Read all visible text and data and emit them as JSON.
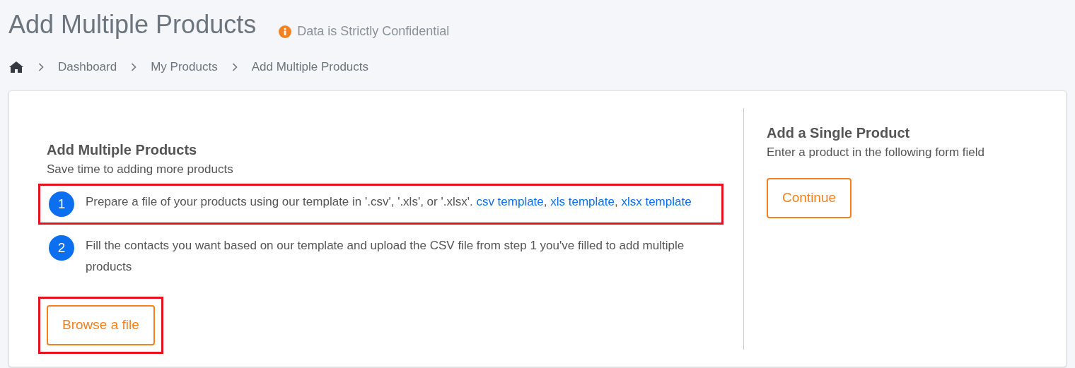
{
  "page_title": "Add Multiple Products",
  "notice": "Data is Strictly Confidential",
  "breadcrumb": [
    {
      "label": "Dashboard"
    },
    {
      "label": "My Products"
    },
    {
      "label": "Add Multiple Products"
    }
  ],
  "multiple": {
    "title": "Add Multiple Products",
    "subtitle": "Save time to adding more products",
    "steps": [
      {
        "number": "1",
        "highlighted": true,
        "parts": [
          {
            "kind": "text",
            "text": "Prepare a file of your products using our template in '.csv', '.xls', or '.xlsx'. "
          },
          {
            "kind": "link",
            "text": "csv template"
          },
          {
            "kind": "text",
            "text": ", "
          },
          {
            "kind": "link",
            "text": "xls template"
          },
          {
            "kind": "text",
            "text": ", "
          },
          {
            "kind": "link",
            "text": "xlsx template"
          }
        ]
      },
      {
        "number": "2",
        "highlighted": false,
        "parts": [
          {
            "kind": "text",
            "text": "Fill the contacts you want based on our template and upload the CSV file from step 1 you've filled to add multiple products"
          }
        ]
      }
    ],
    "browse_button": {
      "label": "Browse a file",
      "highlighted": true
    }
  },
  "single": {
    "title": "Add a Single Product",
    "subtitle": "Enter a product in the following form field",
    "button": "Continue"
  }
}
